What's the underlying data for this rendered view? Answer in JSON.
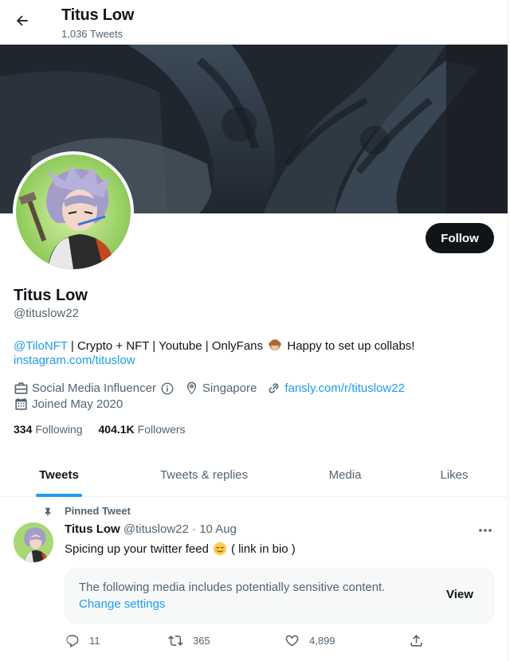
{
  "header": {
    "title": "Titus Low",
    "tweet_count": "1,036 Tweets"
  },
  "profile": {
    "name": "Titus Low",
    "handle": "@tituslow22",
    "follow_label": "Follow",
    "bio": {
      "mention": "@TiloNFT",
      "text_before_emoji": " | Crypto + NFT | Youtube | OnlyFans ",
      "text_after_emoji": " Happy to set up collabs!",
      "link": "instagram.com/tituslow"
    },
    "category": "Social Media Influencer",
    "location": "Singapore",
    "website": "fansly.com/r/tituslow22",
    "joined": "Joined May 2020",
    "following_count": "334",
    "following_label": "Following",
    "followers_count": "404.1K",
    "followers_label": "Followers"
  },
  "tabs": [
    {
      "label": "Tweets",
      "active": true
    },
    {
      "label": "Tweets & replies",
      "active": false
    },
    {
      "label": "Media",
      "active": false
    },
    {
      "label": "Likes",
      "active": false
    }
  ],
  "tweet": {
    "pinned_label": "Pinned Tweet",
    "name": "Titus Low",
    "handle": "@tituslow22",
    "dot": "·",
    "date": "10 Aug",
    "text_before_emoji": "Spicing up your twitter feed",
    "text_after_emoji": "( link in bio )",
    "sensitive_text": "The following media includes potentially sensitive content.",
    "sensitive_link": "Change settings",
    "view_label": "View",
    "replies": "11",
    "retweets": "365",
    "likes": "4,899"
  },
  "colors": {
    "accent": "#1d9bf0",
    "text": "#0f1419",
    "secondary": "#536471",
    "follow_bg": "#0f1419"
  },
  "icons": [
    "back-arrow-icon",
    "briefcase-icon",
    "info-icon",
    "location-pin-icon",
    "link-icon",
    "calendar-icon",
    "pin-icon",
    "more-icon",
    "reply-icon",
    "retweet-icon",
    "like-icon",
    "share-icon",
    "monkey-emoji-icon",
    "relieved-face-emoji-icon"
  ]
}
